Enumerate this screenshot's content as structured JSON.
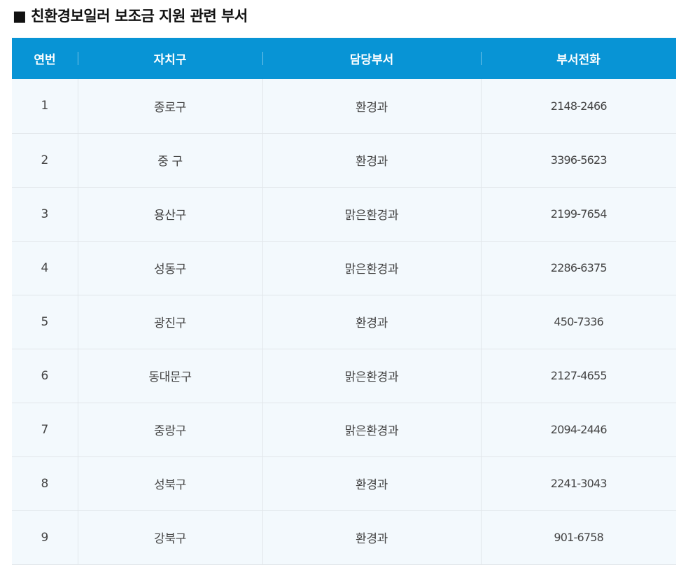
{
  "title": "■ 친환경보일러 보조금 지원 관련 부서",
  "table": {
    "headers": [
      "연번",
      "자치구",
      "담당부서",
      "부서전화"
    ],
    "rows": [
      {
        "no": "1",
        "district": "종로구",
        "dept": "환경과",
        "phone": "2148-2466"
      },
      {
        "no": "2",
        "district": "중 구",
        "dept": "환경과",
        "phone": "3396-5623"
      },
      {
        "no": "3",
        "district": "용산구",
        "dept": "맑은환경과",
        "phone": "2199-7654"
      },
      {
        "no": "4",
        "district": "성동구",
        "dept": "맑은환경과",
        "phone": "2286-6375"
      },
      {
        "no": "5",
        "district": "광진구",
        "dept": "환경과",
        "phone": "450-7336"
      },
      {
        "no": "6",
        "district": "동대문구",
        "dept": "맑은환경과",
        "phone": "2127-4655"
      },
      {
        "no": "7",
        "district": "중랑구",
        "dept": "맑은환경과",
        "phone": "2094-2446"
      },
      {
        "no": "8",
        "district": "성북구",
        "dept": "환경과",
        "phone": "2241-3043"
      },
      {
        "no": "9",
        "district": "강북구",
        "dept": "환경과",
        "phone": "901-6758"
      }
    ]
  },
  "colors": {
    "header_bg": "#0894d5",
    "row_bg": "#f3f9fd"
  }
}
